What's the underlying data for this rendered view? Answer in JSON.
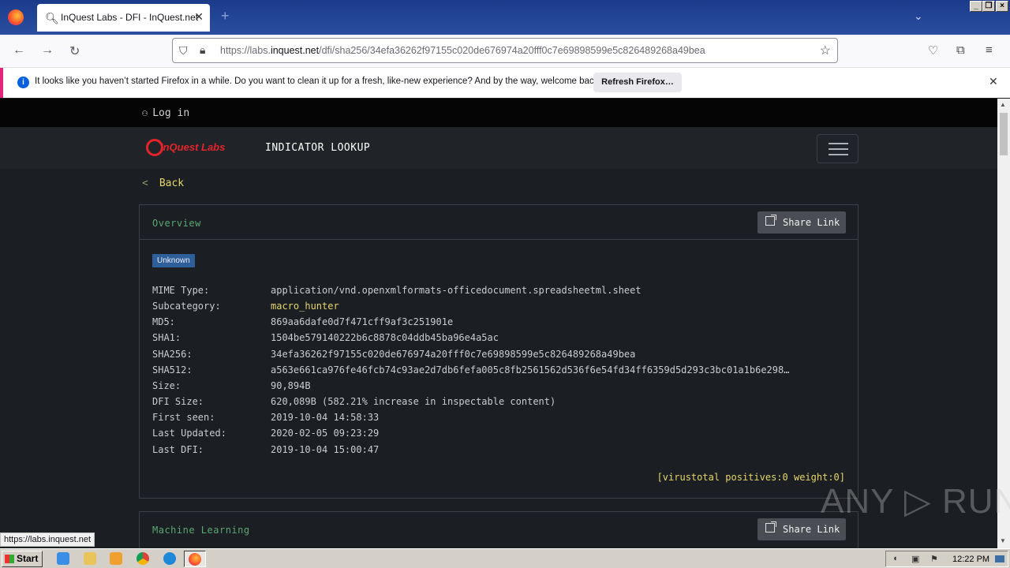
{
  "browser": {
    "tab_title": "InQuest Labs - DFI - InQuest.net",
    "url_prefix": "https://labs.",
    "url_domain": "inquest.net",
    "url_path": "/dfi/sha256/34efa36262f97155c020de676974a20fff0c7e69898599e5c826489268a49bea",
    "notification": "It looks like you haven’t started Firefox in a while. Do you want to clean it up for a fresh, like-new experience? And by the way, welcome back!",
    "refresh_label": "Refresh Firefox…",
    "status_url": "https://labs.inquest.net"
  },
  "site": {
    "login_label": "Log in",
    "logo_text": "InQuest Labs",
    "title": "INDICATOR LOOKUP",
    "back_label": "Back"
  },
  "overview": {
    "title": "Overview",
    "share_label": "Share Link",
    "badge": "Unknown",
    "fields": [
      {
        "key": "MIME Type:",
        "value": "application/vnd.openxmlformats-officedocument.spreadsheetml.sheet"
      },
      {
        "key": "Subcategory:",
        "value": "macro_hunter"
      },
      {
        "key": "MD5:",
        "value": "869aa6dafe0d7f471cff9af3c251901e"
      },
      {
        "key": "SHA1:",
        "value": "1504be579140222b6c8878c04ddb45ba96e4a5ac"
      },
      {
        "key": "SHA256:",
        "value": "34efa36262f97155c020de676974a20fff0c7e69898599e5c826489268a49bea"
      },
      {
        "key": "SHA512:",
        "value": "a563e661ca976fe46fcb74c93ae2d7db6fefa005c8fb2561562d536f6e54fd34ff6359d5d293c3bc01a1b6e298…"
      },
      {
        "key": "Size:",
        "value": "90,894B"
      },
      {
        "key": "DFI Size:",
        "value": "620,089B (582.21% increase in inspectable content)"
      },
      {
        "key": "First seen:",
        "value": "2019-10-04 14:58:33"
      },
      {
        "key": "Last Updated:",
        "value": "2020-02-05 09:23:29"
      },
      {
        "key": "Last DFI:",
        "value": "2019-10-04 15:00:47"
      }
    ],
    "virustotal": "[virustotal positives:0 weight:0]"
  },
  "ml": {
    "title": "Machine Learning",
    "share_label": "Share Link"
  },
  "taskbar": {
    "start_label": "Start",
    "clock": "12:22 PM"
  },
  "watermark": "ANY ▷ RUN"
}
